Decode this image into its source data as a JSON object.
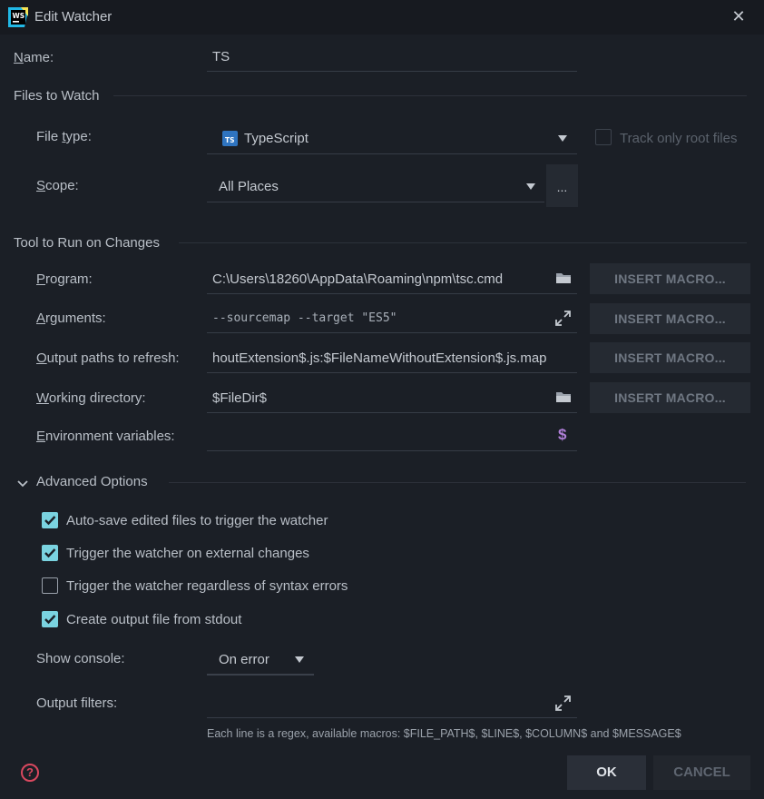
{
  "window": {
    "title": "Edit Watcher",
    "app_icon_text": "WS"
  },
  "name": {
    "label_u": "N",
    "label_rest": "ame:",
    "value": "TS"
  },
  "files_to_watch": {
    "section": "Files to Watch",
    "file_type": {
      "label_pre": "File ",
      "label_u": "t",
      "label_rest": "ype:",
      "value": "TypeScript",
      "icon_text": "TS"
    },
    "track_root": {
      "label": "Track only root files",
      "checked": false
    },
    "scope": {
      "label_u": "S",
      "label_rest": "cope:",
      "value": "All Places",
      "browse": "..."
    }
  },
  "tool": {
    "section": "Tool to Run on Changes",
    "program": {
      "label_u": "P",
      "label_rest": "rogram:",
      "value": "C:\\Users\\18260\\AppData\\Roaming\\npm\\tsc.cmd"
    },
    "arguments": {
      "label_u": "A",
      "label_rest": "rguments:",
      "value": "--sourcemap --target \"ES5\""
    },
    "output_paths": {
      "label_u": "O",
      "label_rest": "utput paths to refresh:",
      "value": "houtExtension$.js:$FileNameWithoutExtension$.js.map"
    },
    "working_dir": {
      "label_u": "W",
      "label_rest": "orking directory:",
      "value": "$FileDir$"
    },
    "env": {
      "label_u": "E",
      "label_rest": "nvironment variables:",
      "value": "",
      "icon_glyph": "$"
    },
    "insert_macro": "INSERT MACRO..."
  },
  "advanced": {
    "section": "Advanced Options",
    "auto_save": "Auto-save edited files to trigger the watcher",
    "external_changes": "Trigger the watcher on external changes",
    "syntax_errors": "Trigger the watcher regardless of syntax errors",
    "stdout": "Create output file from stdout",
    "show_console": {
      "label": "Show console:",
      "value": "On error"
    },
    "output_filters": {
      "label": "Output filters:",
      "value": ""
    },
    "hint": "Each line is a regex, available macros: $FILE_PATH$, $LINE$, $COLUMN$ and $MESSAGE$"
  },
  "buttons": {
    "ok": "OK",
    "cancel": "CANCEL",
    "help": "?"
  },
  "colors": {
    "background": "#1b1f26",
    "accent": "#7ad3e0",
    "env_icon": "#b07fd8",
    "help": "#d9485f"
  }
}
